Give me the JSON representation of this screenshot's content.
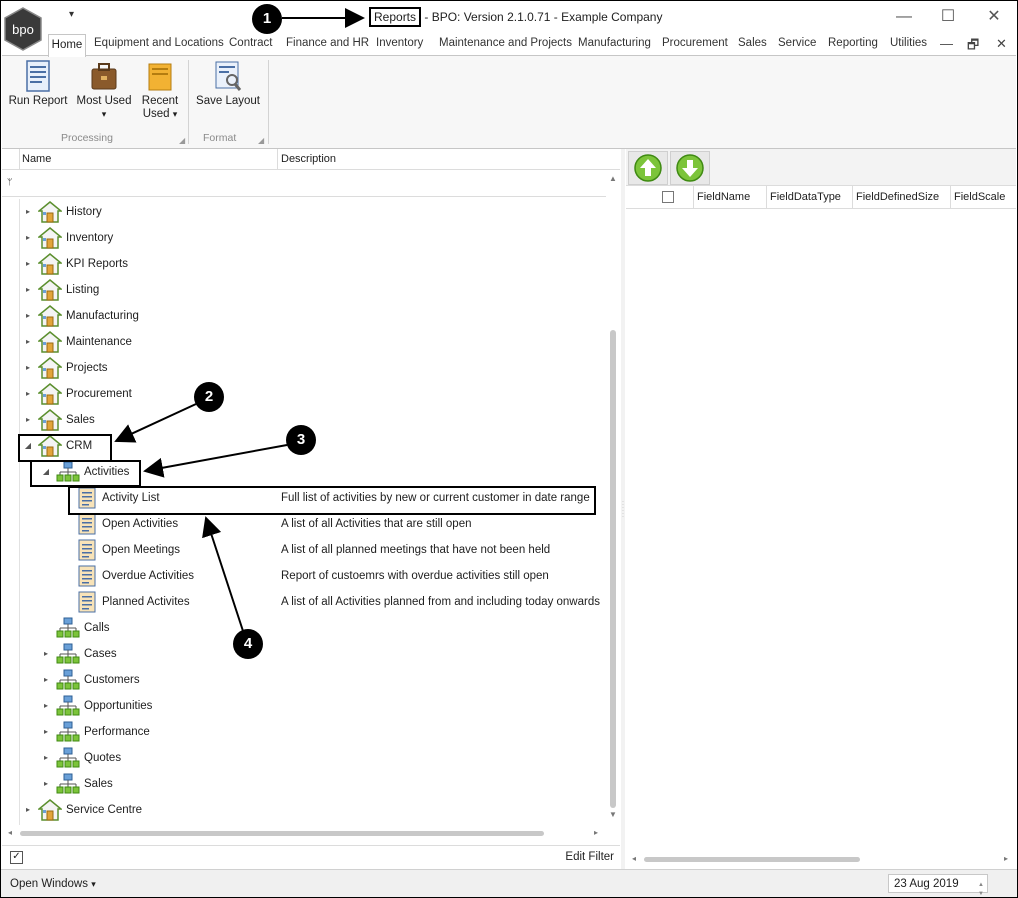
{
  "window": {
    "title_prefix": "Reports",
    "title_rest": " - BPO: Version 2.1.0.71 - Example Company",
    "minimize_glyph": "—",
    "maximize_glyph": "☐",
    "close_glyph": "✕",
    "qat_glyph": "▾",
    "logo_text": "bpo"
  },
  "tabs": [
    "Home",
    "Equipment and Locations",
    "Contract",
    "Finance and HR",
    "Inventory",
    "Maintenance and Projects",
    "Manufacturing",
    "Procurement",
    "Sales",
    "Service",
    "Reporting",
    "Utilities"
  ],
  "mdi": {
    "min": "—",
    "restore": "🗗",
    "close": "✕"
  },
  "ribbon": {
    "run_report": "Run Report",
    "most_used": "Most Used",
    "recent_used_1": "Recent",
    "recent_used_2": "Used",
    "save_layout": "Save Layout",
    "group_processing": "Processing",
    "group_format": "Format",
    "dropdown_glyph": "▾"
  },
  "left": {
    "col_name": "Name",
    "col_description": "Description",
    "edit_filter": "Edit Filter",
    "pin_glyph": "📌"
  },
  "tree": [
    {
      "label": "History",
      "level": 0,
      "icon": "house-icon",
      "exp": "▸"
    },
    {
      "label": "Inventory",
      "level": 0,
      "icon": "house-icon",
      "exp": "▸"
    },
    {
      "label": "KPI Reports",
      "level": 0,
      "icon": "house-icon",
      "exp": "▸"
    },
    {
      "label": "Listing",
      "level": 0,
      "icon": "house-icon",
      "exp": "▸"
    },
    {
      "label": "Manufacturing",
      "level": 0,
      "icon": "house-icon",
      "exp": "▸"
    },
    {
      "label": "Maintenance",
      "level": 0,
      "icon": "house-icon",
      "exp": "▸"
    },
    {
      "label": "Projects",
      "level": 0,
      "icon": "house-icon",
      "exp": "▸"
    },
    {
      "label": "Procurement",
      "level": 0,
      "icon": "house-icon",
      "exp": "▸"
    },
    {
      "label": "Sales",
      "level": 0,
      "icon": "house-icon",
      "exp": "▸"
    },
    {
      "label": "CRM",
      "level": 0,
      "icon": "house-icon",
      "exp": "◢"
    },
    {
      "label": "Activities",
      "level": 1,
      "icon": "org-chart-icon",
      "exp": "◢"
    },
    {
      "label": "Activity List",
      "level": 2,
      "icon": "report-icon",
      "exp": "",
      "desc": "Full list of activities by new or current customer in date range"
    },
    {
      "label": "Open Activities",
      "level": 2,
      "icon": "report-icon",
      "exp": "",
      "desc": "A list of all Activities that are still open"
    },
    {
      "label": "Open Meetings",
      "level": 2,
      "icon": "report-icon",
      "exp": "",
      "desc": "A list of all planned meetings that have not been held"
    },
    {
      "label": "Overdue Activities",
      "level": 2,
      "icon": "report-icon",
      "exp": "",
      "desc": "Report of custoemrs with overdue activities still open"
    },
    {
      "label": "Planned Activites",
      "level": 2,
      "icon": "report-icon",
      "exp": "",
      "desc": "A list of all Activities planned from and including today onwards"
    },
    {
      "label": "Calls",
      "level": 1,
      "icon": "org-chart-icon",
      "exp": ""
    },
    {
      "label": "Cases",
      "level": 1,
      "icon": "org-chart-icon",
      "exp": "▸"
    },
    {
      "label": "Customers",
      "level": 1,
      "icon": "org-chart-icon",
      "exp": "▸"
    },
    {
      "label": "Opportunities",
      "level": 1,
      "icon": "org-chart-icon",
      "exp": "▸"
    },
    {
      "label": "Performance",
      "level": 1,
      "icon": "org-chart-icon",
      "exp": "▸"
    },
    {
      "label": "Quotes",
      "level": 1,
      "icon": "org-chart-icon",
      "exp": "▸"
    },
    {
      "label": "Sales",
      "level": 1,
      "icon": "org-chart-icon",
      "exp": "▸"
    },
    {
      "label": "Service Centre",
      "level": 0,
      "icon": "house-icon",
      "exp": "▸"
    }
  ],
  "right": {
    "columns": [
      "FieldName",
      "FieldDataType",
      "FieldDefinedSize",
      "FieldScale"
    ]
  },
  "status": {
    "open_windows": "Open Windows",
    "date": "23 Aug 2019"
  },
  "callouts": [
    "1",
    "2",
    "3",
    "4"
  ]
}
